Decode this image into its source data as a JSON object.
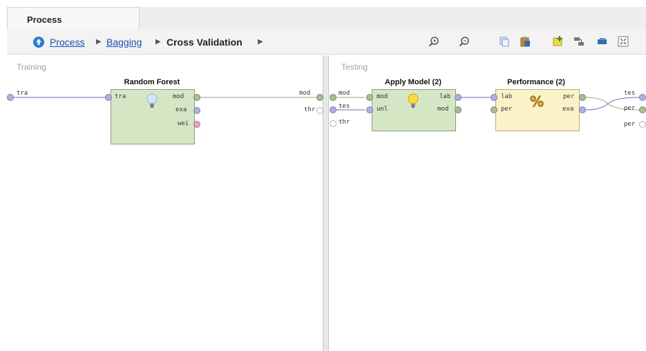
{
  "tab": {
    "label": "Process"
  },
  "breadcrumb": {
    "items": [
      {
        "label": "Process",
        "type": "link"
      },
      {
        "label": "Bagging",
        "type": "link"
      },
      {
        "label": "Cross Validation",
        "type": "current"
      }
    ]
  },
  "toolbar": {
    "icons": [
      "zoom-in-icon",
      "zoom-out-icon",
      "copy-icon",
      "paste-icon",
      "add-note-icon",
      "auto-wire-icon",
      "arrange-icon",
      "fit-icon"
    ]
  },
  "training": {
    "title": "Training",
    "input_ports": [
      "tra"
    ],
    "output_ports": [
      "mod"
    ],
    "operators": [
      {
        "name": "Random Forest",
        "in_ports": [
          "tra"
        ],
        "out_ports": [
          "mod",
          "exa",
          "wei"
        ],
        "icon": "lightbulb-icon"
      }
    ]
  },
  "testing": {
    "title": "Testing",
    "input_ports": [
      "mod",
      "tes",
      "thr"
    ],
    "output_ports": [
      "tes",
      "per",
      "per"
    ],
    "operators": [
      {
        "name": "Apply Model (2)",
        "in_ports": [
          "mod",
          "unl"
        ],
        "out_ports": [
          "lab",
          "mod"
        ],
        "icon": "lightbulb-icon"
      },
      {
        "name": "Performance (2)",
        "in_ports": [
          "lab",
          "per"
        ],
        "out_ports": [
          "per",
          "exa"
        ],
        "icon": "percent-icon"
      }
    ]
  },
  "colors": {
    "accent": "#1a4fb0",
    "green_op": "#d5e6c4",
    "yellow_op": "#fbf2c7"
  }
}
